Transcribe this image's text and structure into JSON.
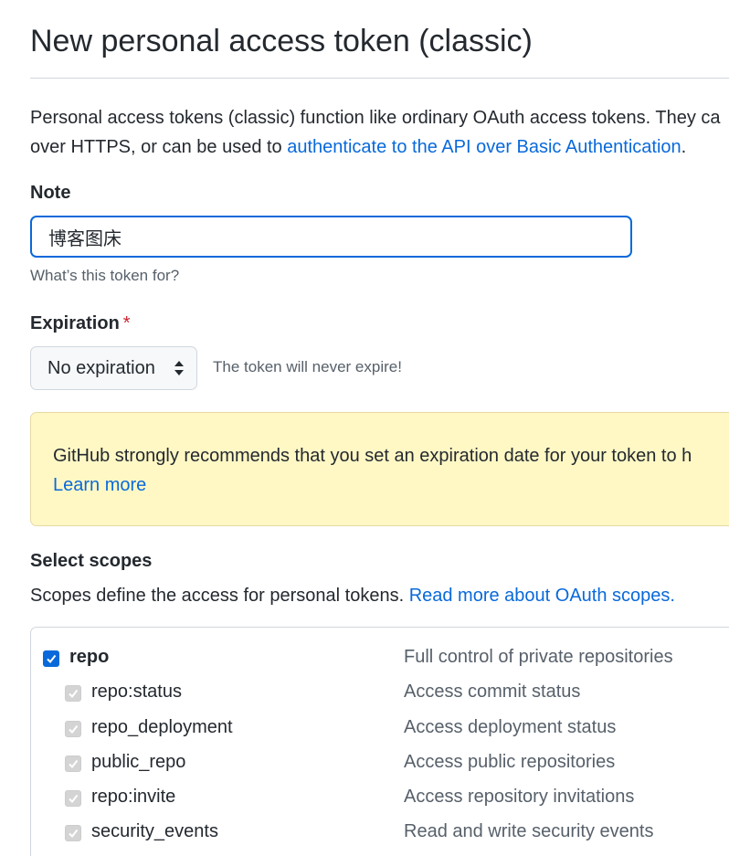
{
  "page": {
    "title": "New personal access token (classic)",
    "intro_line1": "Personal access tokens (classic) function like ordinary OAuth access tokens. They ca",
    "intro_line2_prefix": "over HTTPS, or can be used to ",
    "intro_link": "authenticate to the API over Basic Authentication",
    "intro_line2_suffix": "."
  },
  "note": {
    "label": "Note",
    "value": "博客图床",
    "hint": "What’s this token for?"
  },
  "expiration": {
    "label": "Expiration",
    "required_mark": "*",
    "selected": "No expiration",
    "hint": "The token will never expire!"
  },
  "warning": {
    "text": "GitHub strongly recommends that you set an expiration date for your token to h",
    "link": "Learn more",
    "background": "#fff8c5"
  },
  "scopes": {
    "label": "Select scopes",
    "description_prefix": "Scopes define the access for personal tokens. ",
    "description_link": "Read more about OAuth scopes.",
    "items": [
      {
        "name": "repo",
        "description": "Full control of private repositories",
        "checked": true,
        "parent": true
      },
      {
        "name": "repo:status",
        "description": "Access commit status",
        "checked": true,
        "parent": false
      },
      {
        "name": "repo_deployment",
        "description": "Access deployment status",
        "checked": true,
        "parent": false
      },
      {
        "name": "public_repo",
        "description": "Access public repositories",
        "checked": true,
        "parent": false
      },
      {
        "name": "repo:invite",
        "description": "Access repository invitations",
        "checked": true,
        "parent": false
      },
      {
        "name": "security_events",
        "description": "Read and write security events",
        "checked": true,
        "parent": false
      }
    ]
  },
  "colors": {
    "accent": "#0969da",
    "required": "#cf222e"
  }
}
